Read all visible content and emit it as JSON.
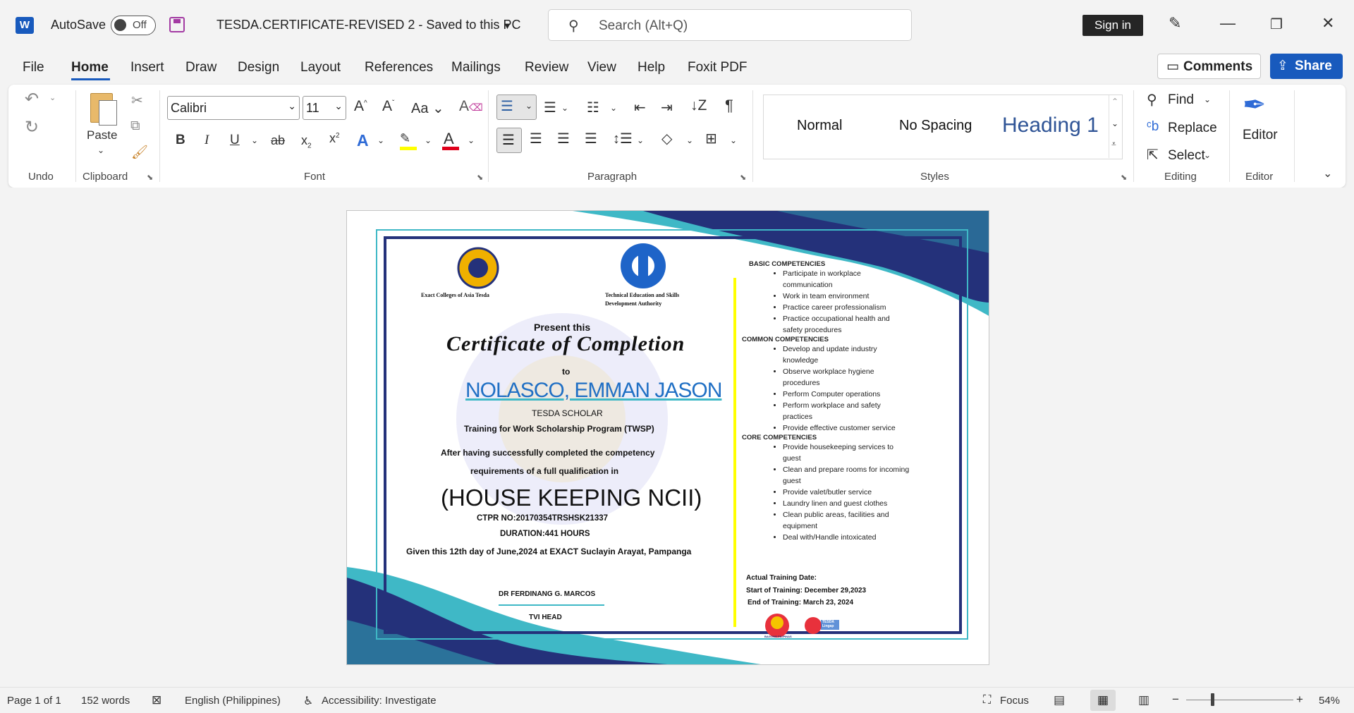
{
  "titlebar": {
    "autosave_label": "AutoSave",
    "autosave_state": "Off",
    "doc_title": "TESDA.CERTIFICATE-REVISED 2  -  Saved to this PC",
    "search_placeholder": "Search (Alt+Q)",
    "signin": "Sign in"
  },
  "menu": {
    "tabs": [
      "File",
      "Home",
      "Insert",
      "Draw",
      "Design",
      "Layout",
      "References",
      "Mailings",
      "Review",
      "View",
      "Help",
      "Foxit PDF"
    ],
    "comments": "Comments",
    "share": "Share"
  },
  "ribbon": {
    "groups": {
      "undo": "Undo",
      "clipboard": "Clipboard",
      "font": "Font",
      "paragraph": "Paragraph",
      "styles": "Styles",
      "editing": "Editing",
      "editor": "Editor"
    },
    "paste": "Paste",
    "font_name": "Calibri",
    "font_size": "11",
    "styles": [
      "Normal",
      "No Spacing",
      "Heading 1"
    ],
    "find": "Find",
    "replace": "Replace",
    "select": "Select",
    "editor": "Editor"
  },
  "certificate": {
    "left_logo_caption": "Exact Colleges of Asia Tesda",
    "right_logo_caption_1": "Technical Education and Skills",
    "right_logo_caption_2": "Development Authority",
    "present": "Present  this",
    "title": "Certificate of Completion",
    "to": "to",
    "name": "NOLASCO, EMMAN JASON",
    "scholar": "TESDA SCHOLAR",
    "program": "Training  for Work Scholarship  Program  (TWSP)",
    "after_1": "After having successfully completed the competency",
    "after_2": "requirements of a full qualification in",
    "qualification": "(HOUSE KEEPING NCII)",
    "ctpr": "CTPR NO:20170354TRSHSK21337",
    "duration": "DURATION:441 HOURS",
    "given": "Given this 12th day of June,2024 at EXACT Suclayin Arayat, Pampanga",
    "signatory": "DR FERDINANG G. MARCOS",
    "signatory_title": "TVI HEAD",
    "competencies": {
      "basic_title": "BASIC COMPETENCIES",
      "basic": [
        "Participate in workplace communication",
        "Work in team environment",
        "Practice career professionalism",
        "Practice occupational health and safety procedures"
      ],
      "common_title": "COMMON COMPETENCIES",
      "common": [
        "Develop and update industry knowledge",
        "Observe workplace hygiene procedures",
        "Perform Computer operations",
        "Perform workplace and safety practices",
        "Provide effective customer service"
      ],
      "core_title": "CORE COMPETENCIES",
      "core": [
        "Provide housekeeping services to guest",
        "Clean and prepare rooms for incoming guest",
        "Provide valet/butler service",
        "Laundry linen and guest clothes",
        "Clean public areas, facilities and equipment",
        "Deal with/Handle intoxicated"
      ]
    },
    "actual_training": "Actual Training Date:",
    "start": "Start of Training: December 29,2023",
    "end": "End of Training: March 23, 2024",
    "badge_1": "BAGONG PILIPINAS",
    "badge_2": "TESDA Lingap"
  },
  "status": {
    "page": "Page 1 of 1",
    "words": "152 words",
    "language": "English (Philippines)",
    "accessibility": "Accessibility: Investigate",
    "focus": "Focus",
    "zoom": "54%"
  },
  "colors": {
    "word_blue": "#185abd",
    "navy": "#24317a",
    "teal": "#3fb8c6",
    "name_blue": "#1f6fc4"
  }
}
